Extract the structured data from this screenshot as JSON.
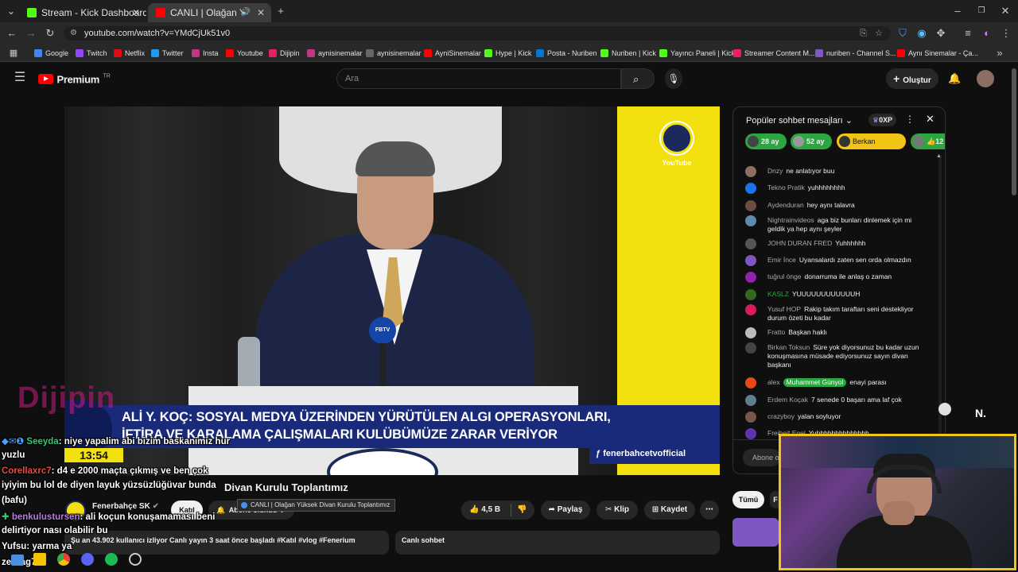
{
  "tabs": [
    {
      "title": "Stream - Kick Dashboard",
      "active": false
    },
    {
      "title": "CANLI | Olağan Yüksek",
      "active": true
    }
  ],
  "url": "youtube.com/watch?v=YMdCjUk51v0",
  "bookmarks": [
    "Google",
    "Twitch",
    "Netflix",
    "Twitter",
    "Insta",
    "Youtube",
    "Dijipin",
    "aynisinemalar",
    "aynisinemalar",
    "AyniSinemalar",
    "Hype | Kick",
    "Posta - Nuriben",
    "Nuriben | Kick",
    "Yayıncı Paneli | Kick",
    "Streamer Content M...",
    "nuriben - Channel S...",
    "Aynı Sinemalar - Ça..."
  ],
  "yt": {
    "logo": "Premium",
    "logo_sup": "TR",
    "search_placeholder": "Ara",
    "create_label": "Oluştur"
  },
  "video": {
    "channel_badge": "YouTube",
    "lower_third_line1": "ALİ Y. KOÇ: SOSYAL MEDYA ÜZERİNDEN YÜRÜTÜLEN ALGI OPERASYONLARI,",
    "lower_third_line2": "İFTİRA VE KARALAMA ÇALIŞMALARI KULÜBÜMÜZE ZARAR VERİYOR",
    "time": "13:54",
    "handle": "fenerbahcetvofficial",
    "podium_mic_label": "FBTV",
    "logo_overlay": "Dijipin"
  },
  "below_video": {
    "title": "CANLI | Olağan Yüksek Divan Kurulu Toplantımız",
    "title_fragment": "Divan Kurulu Toplantımız",
    "tooltip": "CANLI | Olağan Yüksek Divan Kurulu Toplantımız",
    "channel": "Fenerbahçe SK",
    "join_label": "Katıl",
    "subscribed_label": "Abone olundu",
    "likes": "4,5 B",
    "share_label": "Paylaş",
    "clip_label": "Klip",
    "save_label": "Kaydet",
    "meta": "Şu an 43.902 kullanıcı izliyor  Canlı yayın 3 saat önce başladı  #Katıl #vlog #Fenerium",
    "live_chat_label": "Canlı sohbet",
    "filter_all": "Tümü",
    "filter_fragment": "F"
  },
  "chat": {
    "header": "Popüler sohbet mesajları",
    "points": "0XP",
    "pinned": [
      {
        "label": "28 ay",
        "color": "#2ba640"
      },
      {
        "label": "52 ay",
        "color": "#2ba640"
      },
      {
        "label": "Berkan",
        "color": "#f2c414"
      },
      {
        "label": "12",
        "color": "#2ba640"
      }
    ],
    "messages": [
      {
        "author": "Dnzy",
        "text": "ne anlatıyor buu",
        "color": "#8d6e63"
      },
      {
        "author": "Tekno Pratik",
        "text": "yuhhhhhhhh",
        "color": "#1a73e8"
      },
      {
        "author": "Aydenduran",
        "text": "hey aynı talavra",
        "color": "#6d4c41"
      },
      {
        "author": "Nightrainvideos",
        "text": "aga biz bunları dinlemek için mi geldik ya hep aynı şeyler",
        "color": "#5d8aa8"
      },
      {
        "author": "JOHN DURAN FRED",
        "text": "Yuhhhhhh",
        "color": "#555"
      },
      {
        "author": "Emir İnce",
        "text": "Uyansalardı zaten sen orda olmazdın",
        "color": "#7e57c2"
      },
      {
        "author": "tuğrul önge",
        "text": "donarruma ile anlaş o zaman",
        "color": "#8e24aa"
      },
      {
        "author": "KASLZ",
        "text": "YUUUUUUUUUUUUH",
        "color": "#33691e"
      },
      {
        "author": "Yusuf HOP",
        "text": "Rakip takım taraftarı seni destekliyor durum özeti bu kadar",
        "color": "#d81b60"
      },
      {
        "author": "Fratto",
        "text": "Başkan haklı",
        "color": "#bbb"
      },
      {
        "author": "Birkan Toksun",
        "text": "Süre yok diyorsunuz bu kadar uzun konuşmasına müsade ediyorsunuz sayın divan başkanı",
        "color": "#444"
      },
      {
        "author": "alex",
        "text": "enayi parası",
        "color": "#e64a19"
      },
      {
        "author": "Erdem Koçak",
        "text": "7 senede 0 başarı ama laf çok",
        "color": "#607d8b"
      },
      {
        "author": "crazyboy",
        "text": "yalan soyluyor",
        "color": "#795548"
      },
      {
        "author": "Freibeit Egel",
        "text": "Yuhhhhhhhhhhhhhh",
        "color": "#5e35b1"
      }
    ],
    "mention": "Muhammet Günyol",
    "input_placeholder": "Abone o"
  },
  "overlay_chat": [
    {
      "user": "Seeyda",
      "text": ": niye yapalim abi bizim baskanimiz hur",
      "color": "#2ecc71"
    },
    {
      "user": "",
      "text": "yuzlu",
      "color": "#fff"
    },
    {
      "user": "Corellaxrc7",
      "text": ": d4 e 2000 maçta çıkmış ve ben çok",
      "color": "#e74c3c"
    },
    {
      "user": "",
      "text": "iyiyim bu lol de diyen layuk yüzsüzlüğüvar bunda",
      "color": "#fff"
    },
    {
      "user": "",
      "text": "(bafu)",
      "color": "#fff"
    },
    {
      "user": "benkulustursen",
      "text": ": ali koçun konuşamaması beni",
      "color": "#9b59b6"
    },
    {
      "user": "",
      "text": "delirtiyor nası olabilir bu",
      "color": "#fff"
    },
    {
      "user": "Yufsu",
      "text": ": yarma ya",
      "color": "#fff"
    },
    {
      "user": "zedrag78",
      "text": ":",
      "color": "#fff"
    }
  ]
}
